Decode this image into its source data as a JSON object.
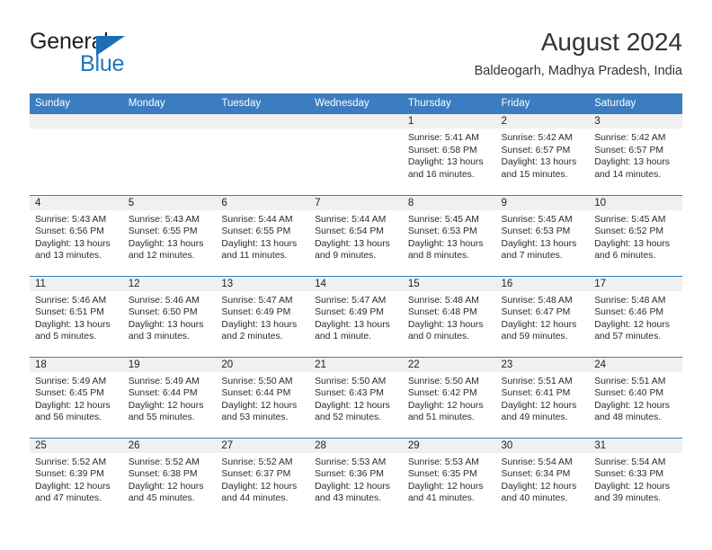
{
  "brand": {
    "word1": "General",
    "word2": "Blue",
    "triangle_icon": "triangle-icon",
    "primary_color": "#1a6fb5"
  },
  "header": {
    "title": "August 2024",
    "subtitle": "Baldeogarh, Madhya Pradesh, India"
  },
  "theme": {
    "header_blue": "#3b7dc0",
    "band_gray": "#f0f0f0",
    "text": "#222222"
  },
  "weekdays": [
    "Sunday",
    "Monday",
    "Tuesday",
    "Wednesday",
    "Thursday",
    "Friday",
    "Saturday"
  ],
  "weeks": [
    [
      {
        "day": ""
      },
      {
        "day": ""
      },
      {
        "day": ""
      },
      {
        "day": ""
      },
      {
        "day": "1",
        "sunrise": "Sunrise: 5:41 AM",
        "sunset": "Sunset: 6:58 PM",
        "daylight1": "Daylight: 13 hours",
        "daylight2": "and 16 minutes."
      },
      {
        "day": "2",
        "sunrise": "Sunrise: 5:42 AM",
        "sunset": "Sunset: 6:57 PM",
        "daylight1": "Daylight: 13 hours",
        "daylight2": "and 15 minutes."
      },
      {
        "day": "3",
        "sunrise": "Sunrise: 5:42 AM",
        "sunset": "Sunset: 6:57 PM",
        "daylight1": "Daylight: 13 hours",
        "daylight2": "and 14 minutes."
      }
    ],
    [
      {
        "day": "4",
        "sunrise": "Sunrise: 5:43 AM",
        "sunset": "Sunset: 6:56 PM",
        "daylight1": "Daylight: 13 hours",
        "daylight2": "and 13 minutes."
      },
      {
        "day": "5",
        "sunrise": "Sunrise: 5:43 AM",
        "sunset": "Sunset: 6:55 PM",
        "daylight1": "Daylight: 13 hours",
        "daylight2": "and 12 minutes."
      },
      {
        "day": "6",
        "sunrise": "Sunrise: 5:44 AM",
        "sunset": "Sunset: 6:55 PM",
        "daylight1": "Daylight: 13 hours",
        "daylight2": "and 11 minutes."
      },
      {
        "day": "7",
        "sunrise": "Sunrise: 5:44 AM",
        "sunset": "Sunset: 6:54 PM",
        "daylight1": "Daylight: 13 hours",
        "daylight2": "and 9 minutes."
      },
      {
        "day": "8",
        "sunrise": "Sunrise: 5:45 AM",
        "sunset": "Sunset: 6:53 PM",
        "daylight1": "Daylight: 13 hours",
        "daylight2": "and 8 minutes."
      },
      {
        "day": "9",
        "sunrise": "Sunrise: 5:45 AM",
        "sunset": "Sunset: 6:53 PM",
        "daylight1": "Daylight: 13 hours",
        "daylight2": "and 7 minutes."
      },
      {
        "day": "10",
        "sunrise": "Sunrise: 5:45 AM",
        "sunset": "Sunset: 6:52 PM",
        "daylight1": "Daylight: 13 hours",
        "daylight2": "and 6 minutes."
      }
    ],
    [
      {
        "day": "11",
        "sunrise": "Sunrise: 5:46 AM",
        "sunset": "Sunset: 6:51 PM",
        "daylight1": "Daylight: 13 hours",
        "daylight2": "and 5 minutes."
      },
      {
        "day": "12",
        "sunrise": "Sunrise: 5:46 AM",
        "sunset": "Sunset: 6:50 PM",
        "daylight1": "Daylight: 13 hours",
        "daylight2": "and 3 minutes."
      },
      {
        "day": "13",
        "sunrise": "Sunrise: 5:47 AM",
        "sunset": "Sunset: 6:49 PM",
        "daylight1": "Daylight: 13 hours",
        "daylight2": "and 2 minutes."
      },
      {
        "day": "14",
        "sunrise": "Sunrise: 5:47 AM",
        "sunset": "Sunset: 6:49 PM",
        "daylight1": "Daylight: 13 hours",
        "daylight2": "and 1 minute."
      },
      {
        "day": "15",
        "sunrise": "Sunrise: 5:48 AM",
        "sunset": "Sunset: 6:48 PM",
        "daylight1": "Daylight: 13 hours",
        "daylight2": "and 0 minutes."
      },
      {
        "day": "16",
        "sunrise": "Sunrise: 5:48 AM",
        "sunset": "Sunset: 6:47 PM",
        "daylight1": "Daylight: 12 hours",
        "daylight2": "and 59 minutes."
      },
      {
        "day": "17",
        "sunrise": "Sunrise: 5:48 AM",
        "sunset": "Sunset: 6:46 PM",
        "daylight1": "Daylight: 12 hours",
        "daylight2": "and 57 minutes."
      }
    ],
    [
      {
        "day": "18",
        "sunrise": "Sunrise: 5:49 AM",
        "sunset": "Sunset: 6:45 PM",
        "daylight1": "Daylight: 12 hours",
        "daylight2": "and 56 minutes."
      },
      {
        "day": "19",
        "sunrise": "Sunrise: 5:49 AM",
        "sunset": "Sunset: 6:44 PM",
        "daylight1": "Daylight: 12 hours",
        "daylight2": "and 55 minutes."
      },
      {
        "day": "20",
        "sunrise": "Sunrise: 5:50 AM",
        "sunset": "Sunset: 6:44 PM",
        "daylight1": "Daylight: 12 hours",
        "daylight2": "and 53 minutes."
      },
      {
        "day": "21",
        "sunrise": "Sunrise: 5:50 AM",
        "sunset": "Sunset: 6:43 PM",
        "daylight1": "Daylight: 12 hours",
        "daylight2": "and 52 minutes."
      },
      {
        "day": "22",
        "sunrise": "Sunrise: 5:50 AM",
        "sunset": "Sunset: 6:42 PM",
        "daylight1": "Daylight: 12 hours",
        "daylight2": "and 51 minutes."
      },
      {
        "day": "23",
        "sunrise": "Sunrise: 5:51 AM",
        "sunset": "Sunset: 6:41 PM",
        "daylight1": "Daylight: 12 hours",
        "daylight2": "and 49 minutes."
      },
      {
        "day": "24",
        "sunrise": "Sunrise: 5:51 AM",
        "sunset": "Sunset: 6:40 PM",
        "daylight1": "Daylight: 12 hours",
        "daylight2": "and 48 minutes."
      }
    ],
    [
      {
        "day": "25",
        "sunrise": "Sunrise: 5:52 AM",
        "sunset": "Sunset: 6:39 PM",
        "daylight1": "Daylight: 12 hours",
        "daylight2": "and 47 minutes."
      },
      {
        "day": "26",
        "sunrise": "Sunrise: 5:52 AM",
        "sunset": "Sunset: 6:38 PM",
        "daylight1": "Daylight: 12 hours",
        "daylight2": "and 45 minutes."
      },
      {
        "day": "27",
        "sunrise": "Sunrise: 5:52 AM",
        "sunset": "Sunset: 6:37 PM",
        "daylight1": "Daylight: 12 hours",
        "daylight2": "and 44 minutes."
      },
      {
        "day": "28",
        "sunrise": "Sunrise: 5:53 AM",
        "sunset": "Sunset: 6:36 PM",
        "daylight1": "Daylight: 12 hours",
        "daylight2": "and 43 minutes."
      },
      {
        "day": "29",
        "sunrise": "Sunrise: 5:53 AM",
        "sunset": "Sunset: 6:35 PM",
        "daylight1": "Daylight: 12 hours",
        "daylight2": "and 41 minutes."
      },
      {
        "day": "30",
        "sunrise": "Sunrise: 5:54 AM",
        "sunset": "Sunset: 6:34 PM",
        "daylight1": "Daylight: 12 hours",
        "daylight2": "and 40 minutes."
      },
      {
        "day": "31",
        "sunrise": "Sunrise: 5:54 AM",
        "sunset": "Sunset: 6:33 PM",
        "daylight1": "Daylight: 12 hours",
        "daylight2": "and 39 minutes."
      }
    ]
  ]
}
